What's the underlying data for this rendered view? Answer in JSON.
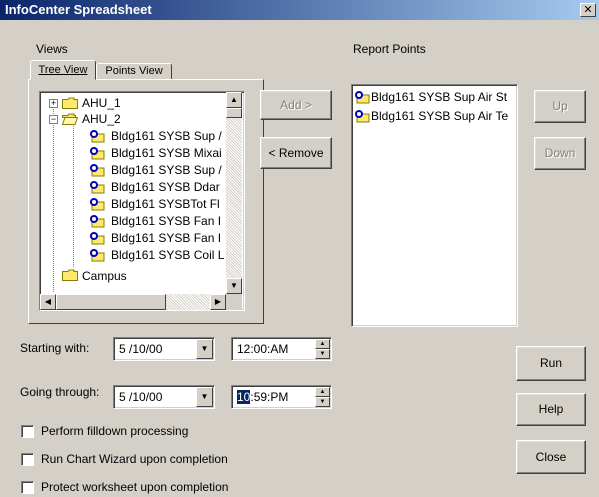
{
  "window": {
    "title": "InfoCenter Spreadsheet",
    "close_glyph": "✕"
  },
  "views": {
    "label": "Views",
    "tabs": [
      {
        "label": "Tree View",
        "active": true
      },
      {
        "label": "Points View",
        "active": false
      }
    ],
    "tree": [
      {
        "label": "AHU_1",
        "type": "folder",
        "expander": "+"
      },
      {
        "label": "AHU_2",
        "type": "folder-open",
        "expander": "−"
      },
      {
        "label": "Bldg161 SYSB Sup /",
        "type": "point"
      },
      {
        "label": "Bldg161 SYSB Mixai",
        "type": "point"
      },
      {
        "label": "Bldg161 SYSB Sup /",
        "type": "point"
      },
      {
        "label": "Bldg161 SYSB Ddar",
        "type": "point"
      },
      {
        "label": "Bldg161 SYSBTot Fl",
        "type": "point"
      },
      {
        "label": "Bldg161 SYSB Fan I",
        "type": "point"
      },
      {
        "label": "Bldg161 SYSB Fan I",
        "type": "point"
      },
      {
        "label": "Bldg161 SYSB Coil L",
        "type": "point"
      },
      {
        "label": "Campus",
        "type": "folder"
      }
    ]
  },
  "buttons": {
    "add": "Add >",
    "remove": "< Remove",
    "up": "Up",
    "down": "Down",
    "run": "Run",
    "help": "Help",
    "close": "Close"
  },
  "report_points": {
    "label": "Report Points",
    "items": [
      "Bldg161 SYSB Sup Air St",
      "Bldg161 SYSB Sup Air Te"
    ]
  },
  "dates": {
    "start_label": "Starting with:",
    "start_date": "5 /10/00",
    "start_time": "12:00:AM",
    "end_label": "Going through:",
    "end_date": "5 /10/00",
    "end_time_selected": "10",
    "end_time_rest": ":59:PM"
  },
  "options": [
    {
      "label": "Perform filldown processing",
      "checked": false
    },
    {
      "label": "Run Chart Wizard upon completion",
      "checked": false
    },
    {
      "label": "Protect worksheet upon completion",
      "checked": false
    }
  ],
  "icons": {
    "folder": "folder-icon",
    "point": "point-icon",
    "scroll_up": "▲",
    "scroll_down": "▼",
    "scroll_left": "◀",
    "scroll_right": "▶",
    "combo": "▼",
    "spin_up": "▲",
    "spin_down": "▼"
  },
  "colors": {
    "titlebar": "#0a246a",
    "face": "#d4d0c8",
    "folder": "#ffe86b",
    "selection": "#0a246a"
  }
}
